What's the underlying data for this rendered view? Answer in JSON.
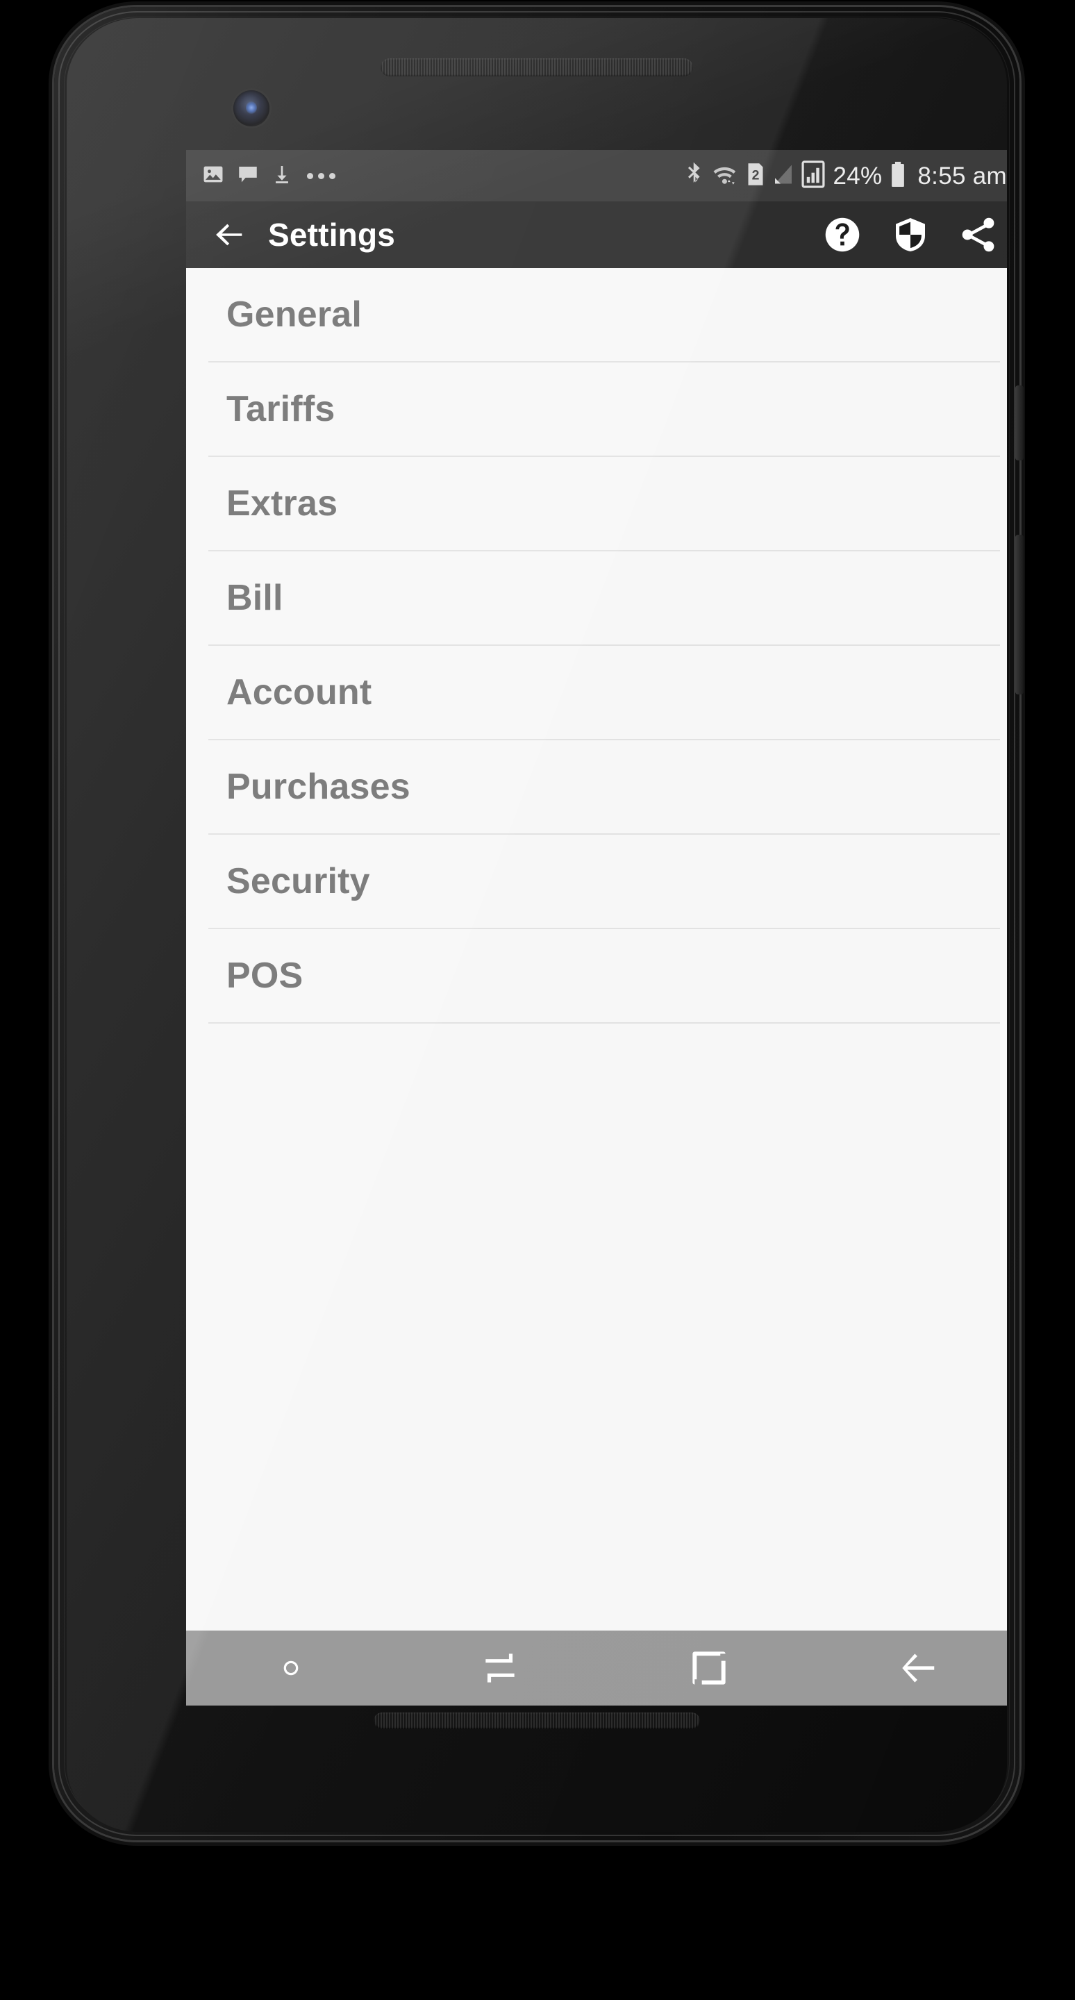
{
  "status_bar": {
    "left_icons": [
      {
        "name": "image-icon",
        "glyph": "image"
      },
      {
        "name": "message-icon",
        "glyph": "message"
      },
      {
        "name": "download-icon",
        "glyph": "download"
      },
      {
        "name": "more-notifications-icon",
        "glyph": "dots"
      }
    ],
    "right_icons": [
      {
        "name": "bluetooth-icon",
        "glyph": "bluetooth"
      },
      {
        "name": "wifi-icon",
        "glyph": "wifi"
      },
      {
        "name": "sim-card-icon",
        "glyph": "sim",
        "label": "2"
      },
      {
        "name": "signal-weak-icon",
        "glyph": "signal-weak"
      },
      {
        "name": "mobile-signal-icon",
        "glyph": "signal-boxed"
      }
    ],
    "battery_percent": "24%",
    "clock": "8:55 am",
    "background_color": "#3a3a3a",
    "text_color": "#ededed"
  },
  "app_bar": {
    "back_label": "Back",
    "title": "Settings",
    "actions": [
      {
        "name": "help-icon",
        "label": "Help"
      },
      {
        "name": "shield-icon",
        "label": "Security"
      },
      {
        "name": "share-icon",
        "label": "Share"
      }
    ],
    "background_color": "#2b2b2b",
    "title_color": "#ffffff"
  },
  "settings_list": {
    "background_color": "#f7f7f7",
    "label_color": "#727272",
    "divider_color": "#e2e2e2",
    "items": [
      {
        "label": "General"
      },
      {
        "label": "Tariffs"
      },
      {
        "label": "Extras"
      },
      {
        "label": "Bill"
      },
      {
        "label": "Account"
      },
      {
        "label": "Purchases"
      },
      {
        "label": "Security"
      },
      {
        "label": "POS"
      }
    ]
  },
  "nav_bar": {
    "background_color": "#9a9a9a",
    "buttons": [
      {
        "name": "nav-dot-icon",
        "label": "Dot"
      },
      {
        "name": "nav-switch-icon",
        "label": "Switch"
      },
      {
        "name": "nav-home-icon",
        "label": "Home"
      },
      {
        "name": "nav-back-icon",
        "label": "Back"
      }
    ]
  }
}
